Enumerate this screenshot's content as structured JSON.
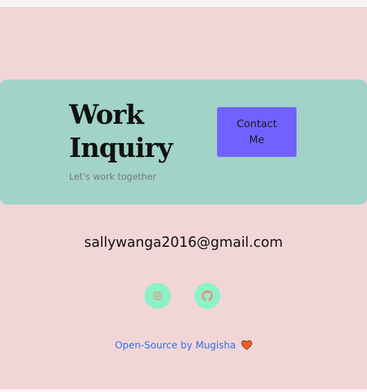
{
  "hero": {
    "title_line1": "Work",
    "title_line2": "Inquiry",
    "subtitle": "Let's work together",
    "contact_label": "Contact Me"
  },
  "contact": {
    "email": "sallywanga2016@gmail.com"
  },
  "social": {
    "icons": [
      "instagram-icon",
      "github-icon"
    ]
  },
  "footer": {
    "credit": "Open-Source by Mugisha",
    "heart_icon": "heart-icon"
  },
  "colors": {
    "background": "#f2d6d7",
    "card": "#a1d3c7",
    "button": "#7162ff",
    "social_circle": "#8df2c6",
    "social_icon": "#e8907f",
    "link": "#3173e8",
    "heart": "#f25d1e"
  }
}
